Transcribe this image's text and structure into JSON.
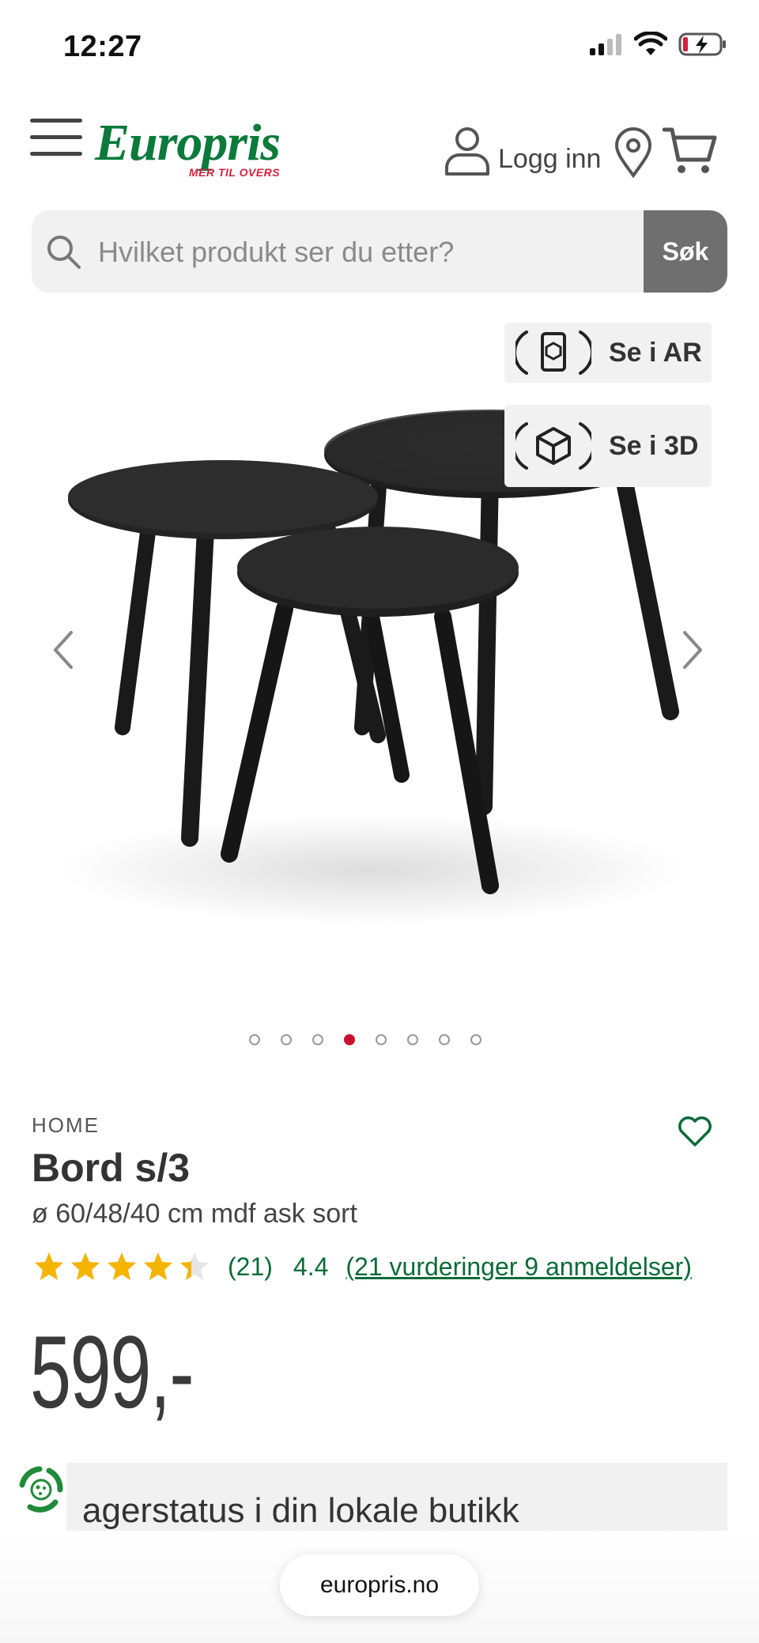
{
  "status_bar": {
    "time": "12:27"
  },
  "header": {
    "logo": {
      "name": "Europris",
      "tagline": "MER TIL OVERS"
    },
    "login_label": "Logg inn"
  },
  "search": {
    "placeholder": "Hvilket produkt ser du etter?",
    "button_label": "Søk"
  },
  "gallery": {
    "ar_label": "Se i AR",
    "view3d_label": "Se i 3D",
    "dot_count": 8,
    "active_dot": 4
  },
  "product": {
    "brand": "HOME",
    "title": "Bord s/3",
    "subtitle": "ø 60/48/40 cm mdf ask sort",
    "rating_value": 4.4,
    "rating_count_label": "(21)",
    "rating_score_label": "4.4",
    "reviews_link": "(21 vurderinger 9 anmeldelser)",
    "price": "599,-"
  },
  "stock": {
    "text": "agerstatus i din lokale butikk"
  },
  "browser": {
    "url": "europris.no"
  },
  "colors": {
    "brand_green": "#0b7a3b",
    "brand_red": "#d61f3c",
    "star": "#f5b400",
    "active_dot": "#c8102e"
  }
}
